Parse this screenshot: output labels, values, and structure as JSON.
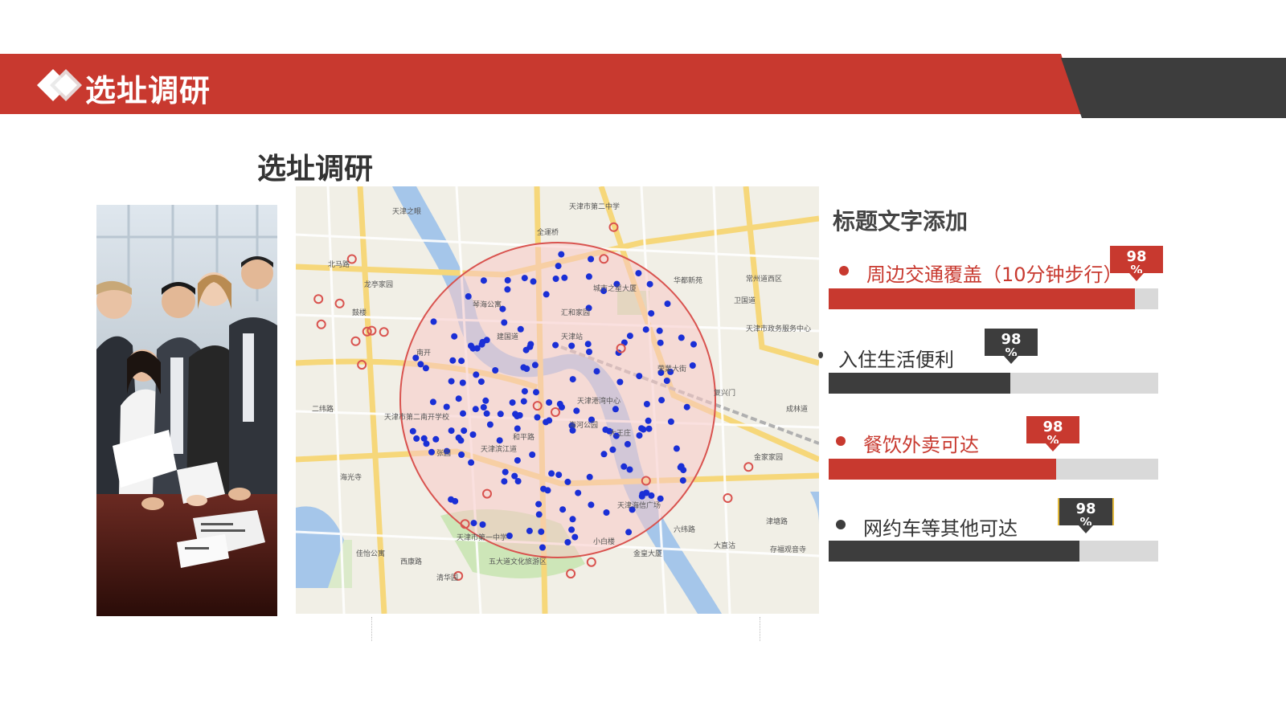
{
  "header": {
    "title": "选址调研"
  },
  "section": {
    "title": "选址调研"
  },
  "panel": {
    "title": "标题文字添加",
    "items": [
      {
        "label": "周边交通覆盖（10分钟步行）",
        "percent": 98,
        "badge": "98",
        "unit": "%",
        "fill": 0.93,
        "color": "#c8392f"
      },
      {
        "label": "入住生活便利",
        "percent": 98,
        "badge": "98",
        "unit": "%",
        "fill": 0.55,
        "color": "#3d3d3d"
      },
      {
        "label": "餐饮外卖可达",
        "percent": 98,
        "badge": "98",
        "unit": "%",
        "fill": 0.69,
        "color": "#c8392f"
      },
      {
        "label": "网约车等其他可达",
        "percent": 98,
        "badge": "98",
        "unit": "%",
        "fill": 0.76,
        "color": "#3d3d3d"
      }
    ]
  },
  "map": {
    "labels": [
      "天津之眼",
      "天津市第二中学",
      "全運桥",
      "天津站",
      "城市之星大厦",
      "华都新苑",
      "常州道西区",
      "汇和家园",
      "琴海公寓",
      "建国道",
      "南开",
      "天津港湾中心",
      "海河公园",
      "大王庄",
      "天津市第二南开学校",
      "张园",
      "和平路",
      "天津海信广场",
      "六纬路",
      "天津市第一中学",
      "小白楼",
      "金皇大厦",
      "五大道文化旅游区",
      "清华园",
      "西康路",
      "佳怡公寓",
      "二纬路",
      "海光寺",
      "北马路",
      "龙亭家园",
      "鼓楼",
      "荣業大街",
      "天津市政务服务中心",
      "卫国道",
      "复兴门",
      "成林道",
      "金家家园",
      "津塘路",
      "存福观音寺",
      "大直沽",
      "天津滨江道"
    ],
    "colors": {
      "water": "#a5c6ea",
      "road": "#f6d77a",
      "circle_fill": "#f7c9c6",
      "circle_stroke": "#d9534f",
      "dot": "#1a2fd6",
      "park": "#cde6b8"
    }
  }
}
